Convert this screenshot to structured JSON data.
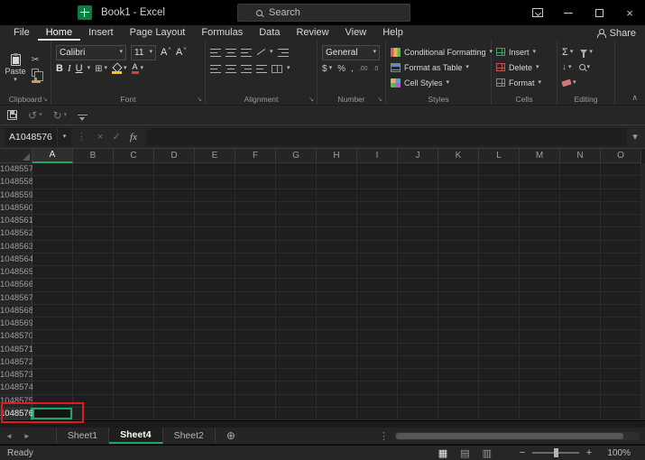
{
  "title_bar": {
    "title": "Book1 - Excel",
    "search_label": "Search"
  },
  "ribbon_tabs": {
    "items": [
      {
        "label": "File"
      },
      {
        "label": "Home"
      },
      {
        "label": "Insert"
      },
      {
        "label": "Page Layout"
      },
      {
        "label": "Formulas"
      },
      {
        "label": "Data"
      },
      {
        "label": "Review"
      },
      {
        "label": "View"
      },
      {
        "label": "Help"
      }
    ],
    "share_label": "Share"
  },
  "ribbon": {
    "clipboard": {
      "label": "Clipboard",
      "paste": "Paste"
    },
    "font": {
      "label": "Font",
      "name": "Calibri",
      "size": "11",
      "bold": "B",
      "italic": "I",
      "underline": "U",
      "letter": "A"
    },
    "alignment": {
      "label": "Alignment"
    },
    "number": {
      "label": "Number",
      "format": "General",
      "currency": "$",
      "percent": "%",
      "comma": ",",
      "increase_decimal": ".00",
      "decrease_decimal": ".0"
    },
    "styles": {
      "label": "Styles",
      "conditional_formatting": "Conditional Formatting",
      "format_as_table": "Format as Table",
      "cell_styles": "Cell Styles"
    },
    "cells": {
      "label": "Cells",
      "insert": "Insert",
      "delete": "Delete",
      "format": "Format"
    },
    "editing": {
      "label": "Editing"
    }
  },
  "formula_bar": {
    "name_box": "A1048576",
    "fx": "fx",
    "value": ""
  },
  "grid": {
    "columns": [
      "A",
      "B",
      "C",
      "D",
      "E",
      "F",
      "G",
      "H",
      "I",
      "J",
      "K",
      "L",
      "M",
      "N",
      "O"
    ],
    "rows": [
      "1048557",
      "1048558",
      "1048559",
      "1048560",
      "1048561",
      "1048562",
      "1048563",
      "1048564",
      "1048565",
      "1048566",
      "1048567",
      "1048568",
      "1048569",
      "1048570",
      "1048571",
      "1048572",
      "1048573",
      "1048574",
      "1048575",
      "1048576"
    ],
    "selected_column": "A",
    "selected_row": "1048576",
    "active_cell": "A1048576"
  },
  "sheet_bar": {
    "tabs": [
      {
        "label": "Sheet1",
        "active": false
      },
      {
        "label": "Sheet4",
        "active": true
      },
      {
        "label": "Sheet2",
        "active": false
      }
    ]
  },
  "status_bar": {
    "ready": "Ready",
    "zoom": "100%"
  },
  "icons": {
    "caret": "▾",
    "undo": "↺",
    "redo": "↻",
    "cancel": "×",
    "check": "✓",
    "sigma": "Σ",
    "prev_sheet": "◄",
    "next_sheet": "►",
    "add_sheet": "⊕",
    "dots_vertical": "⋮",
    "dialog_launcher": "↘",
    "collapse_ribbon": "∧",
    "view_normal": "▦",
    "view_layout": "▤",
    "view_break": "▥",
    "minus": "−",
    "plus": "+",
    "borders": "⊞",
    "cut": "✂",
    "fill_down": "↓",
    "close": "×"
  },
  "colors": {
    "selection_green": "#21a366",
    "annotation_red": "#df1a21"
  }
}
